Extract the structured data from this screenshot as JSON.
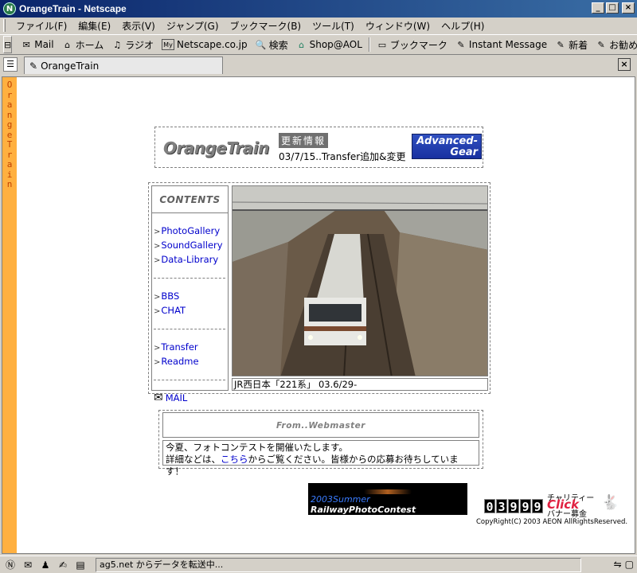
{
  "window": {
    "title": "OrangeTrain - Netscape"
  },
  "menu": [
    "ファイル(F)",
    "編集(E)",
    "表示(V)",
    "ジャンプ(G)",
    "ブックマーク(B)",
    "ツール(T)",
    "ウィンドウ(W)",
    "ヘルプ(H)"
  ],
  "toolbar": [
    {
      "label": "Mail",
      "icon": "mail-icon"
    },
    {
      "label": "ホーム",
      "icon": "home-icon"
    },
    {
      "label": "ラジオ",
      "icon": "radio-icon"
    },
    {
      "label": "Netscape.co.jp",
      "icon": "my-netscape-icon",
      "badge": "My"
    },
    {
      "label": "検索",
      "icon": "search-icon"
    },
    {
      "label": "Shop@AOL",
      "icon": "shop-icon"
    },
    {
      "label": "ブックマーク",
      "icon": "bookmark-folder-icon"
    },
    {
      "label": "Instant Message",
      "icon": "bookmark-icon"
    },
    {
      "label": "新着",
      "icon": "bookmark-icon"
    },
    {
      "label": "お勧め",
      "icon": "bookmark-icon"
    }
  ],
  "tab": {
    "label": "OrangeTrain"
  },
  "sidebar_text": "OrangeTrain",
  "header": {
    "logo": "OrangeTrain",
    "update_label": "更新情報",
    "update_text": "03/7/15..Transfer追加&変更",
    "banner_line1": "Advanced-",
    "banner_line2": "Gear"
  },
  "nav": {
    "title": "CONTENTS",
    "groups": [
      [
        "PhotoGallery",
        "SoundGallery",
        "Data-Library"
      ],
      [
        "BBS",
        "CHAT"
      ],
      [
        "Transfer",
        "Readme"
      ]
    ],
    "mail": "MAIL"
  },
  "photo": {
    "caption": "JR西日本「221系」 03.6/29-"
  },
  "message": {
    "head": "From..Webmaster",
    "line1": "今夏、フォトコンテストを開催いたします。",
    "line2_pre": "詳細などは、",
    "line2_link": "こちら",
    "line2_post": "からご覧ください。皆様からの応募お待ちしています！"
  },
  "contest": {
    "line1": "2003Summer",
    "line2": "RailwayPhotoContest"
  },
  "counter": {
    "value": "03999"
  },
  "charity": {
    "c1": "チャリティー",
    "c2": "Click",
    "c3": "バナー募金"
  },
  "copyright": "CopyRight(C) 2003 AEON AllRightsReserved.",
  "status": {
    "text": "ag5.net からデータを転送中..."
  },
  "colors": {
    "accent": "#ffb040",
    "link": "#0000cc",
    "titlebar": "#0a246a"
  }
}
